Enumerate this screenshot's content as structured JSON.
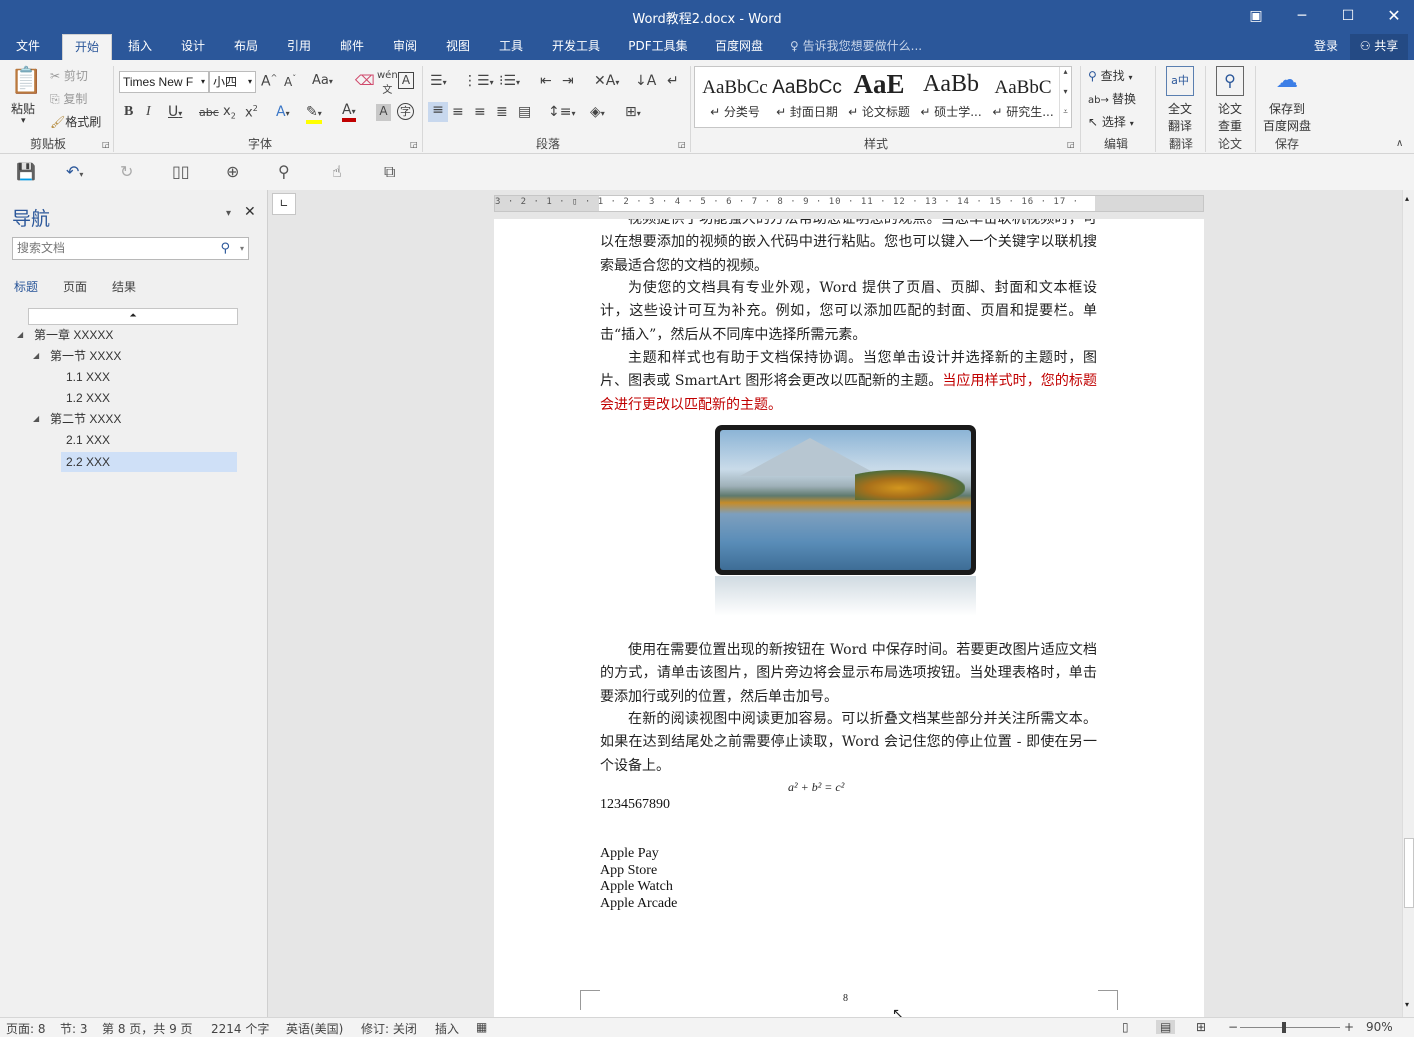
{
  "window": {
    "title": "Word教程2.docx - Word",
    "controls": [
      "restore-ribbon-icon",
      "minimize-icon",
      "maximize-icon",
      "close-icon"
    ]
  },
  "menu": {
    "tabs": [
      "文件",
      "开始",
      "插入",
      "设计",
      "布局",
      "引用",
      "邮件",
      "审阅",
      "视图",
      "工具",
      "开发工具",
      "PDF工具集",
      "百度网盘"
    ],
    "active": "开始",
    "tell_me": "告诉我您想要做什么...",
    "login": "登录",
    "share": "共享"
  },
  "ribbon": {
    "clipboard": {
      "paste": "粘贴",
      "cut": "剪切",
      "copy": "复制",
      "format_painter": "格式刷",
      "label": "剪贴板"
    },
    "font": {
      "name": "Times New F",
      "size": "小四",
      "label": "字体",
      "change_case": "Aa"
    },
    "paragraph": {
      "label": "段落"
    },
    "styles": {
      "label": "样式",
      "items": [
        {
          "sample": "AaBbCc",
          "name": "↵ 分类号"
        },
        {
          "sample": "AaBbCc",
          "name": "↵ 封面日期"
        },
        {
          "sample": "AaE",
          "name": "↵ 论文标题"
        },
        {
          "sample": "AaBb",
          "name": "↵ 硕士学..."
        },
        {
          "sample": "AaBbC",
          "name": "↵ 研究生..."
        }
      ]
    },
    "editing": {
      "find": "查找",
      "replace": "替换",
      "select": "选择",
      "label": "编辑"
    },
    "translate": {
      "full": "全文",
      "full2": "翻译",
      "label": "翻译"
    },
    "paper": {
      "check": "论文",
      "check2": "查重",
      "label": "论文"
    },
    "save": {
      "line1": "保存到",
      "line2": "百度网盘",
      "label": "保存"
    }
  },
  "nav": {
    "title": "导航",
    "search_placeholder": "搜索文档",
    "tabs": [
      "标题",
      "页面",
      "结果"
    ],
    "tree": [
      {
        "label": "第一章 XXXXX",
        "level": 0
      },
      {
        "label": "第一节 XXXX",
        "level": 1
      },
      {
        "label": "1.1 XXX",
        "level": 2
      },
      {
        "label": "1.2 XXX",
        "level": 2
      },
      {
        "label": "第二节 XXXX",
        "level": 1
      },
      {
        "label": "2.1 XXX",
        "level": 2
      },
      {
        "label": "2.2 XXX",
        "level": 2,
        "selected": true
      }
    ]
  },
  "ruler": {
    "marks": "3 · 2 · 1 · ▯ · 1 · 2 · 3 · 4 · 5 · 6 · 7 · 8 · 9 · 10 · 11 · 12 · 13 · 14 · 15 · 16 · 17 ·"
  },
  "document": {
    "p0": "视频提供了功能强大的方法帮助您证明您的观点。当您单击联机视频时，可以在想要添加的视频的嵌入代码中进行粘贴。您也可以键入一个关键字以联机搜索最适合您的文档的视频。",
    "p1": "为使您的文档具有专业外观，Word 提供了页眉、页脚、封面和文本框设计，这些设计可互为补充。例如，您可以添加匹配的封面、页眉和提要栏。单击“插入”，然后从不同库中选择所需元素。",
    "p2_normal": "主题和样式也有助于文档保持协调。当您单击设计并选择新的主题时，图片、图表或 SmartArt 图形将会更改以匹配新的主题。",
    "p2_red": "当应用样式时，您的标题会进行更改以匹配新的主题。",
    "p3": "使用在需要位置出现的新按钮在 Word 中保存时间。若要更改图片适应文档的方式，请单击该图片，图片旁边将会显示布局选项按钮。当处理表格时，单击要添加行或列的位置，然后单击加号。",
    "p4": "在新的阅读视图中阅读更加容易。可以折叠文档某些部分并关注所需文本。如果在达到结尾处之前需要停止读取，Word 会记住您的停止位置 - 即使在另一个设备上。",
    "equation": "a² + b² = c²",
    "number": "1234567890",
    "list": [
      "Apple Pay",
      "App Store",
      "Apple Watch",
      "Apple Arcade"
    ],
    "page_number": "8"
  },
  "status": {
    "page": "页面: 8",
    "section": "节: 3",
    "page_of": "第 8 页，共 9 页",
    "words": "2214 个字",
    "language": "英语(美国)",
    "track": "修订: 关闭",
    "insert": "插入",
    "zoom": "90%"
  },
  "colors": {
    "brand": "#2b579a",
    "red_text": "#c00000",
    "nav_selected": "#cfe0f7"
  }
}
